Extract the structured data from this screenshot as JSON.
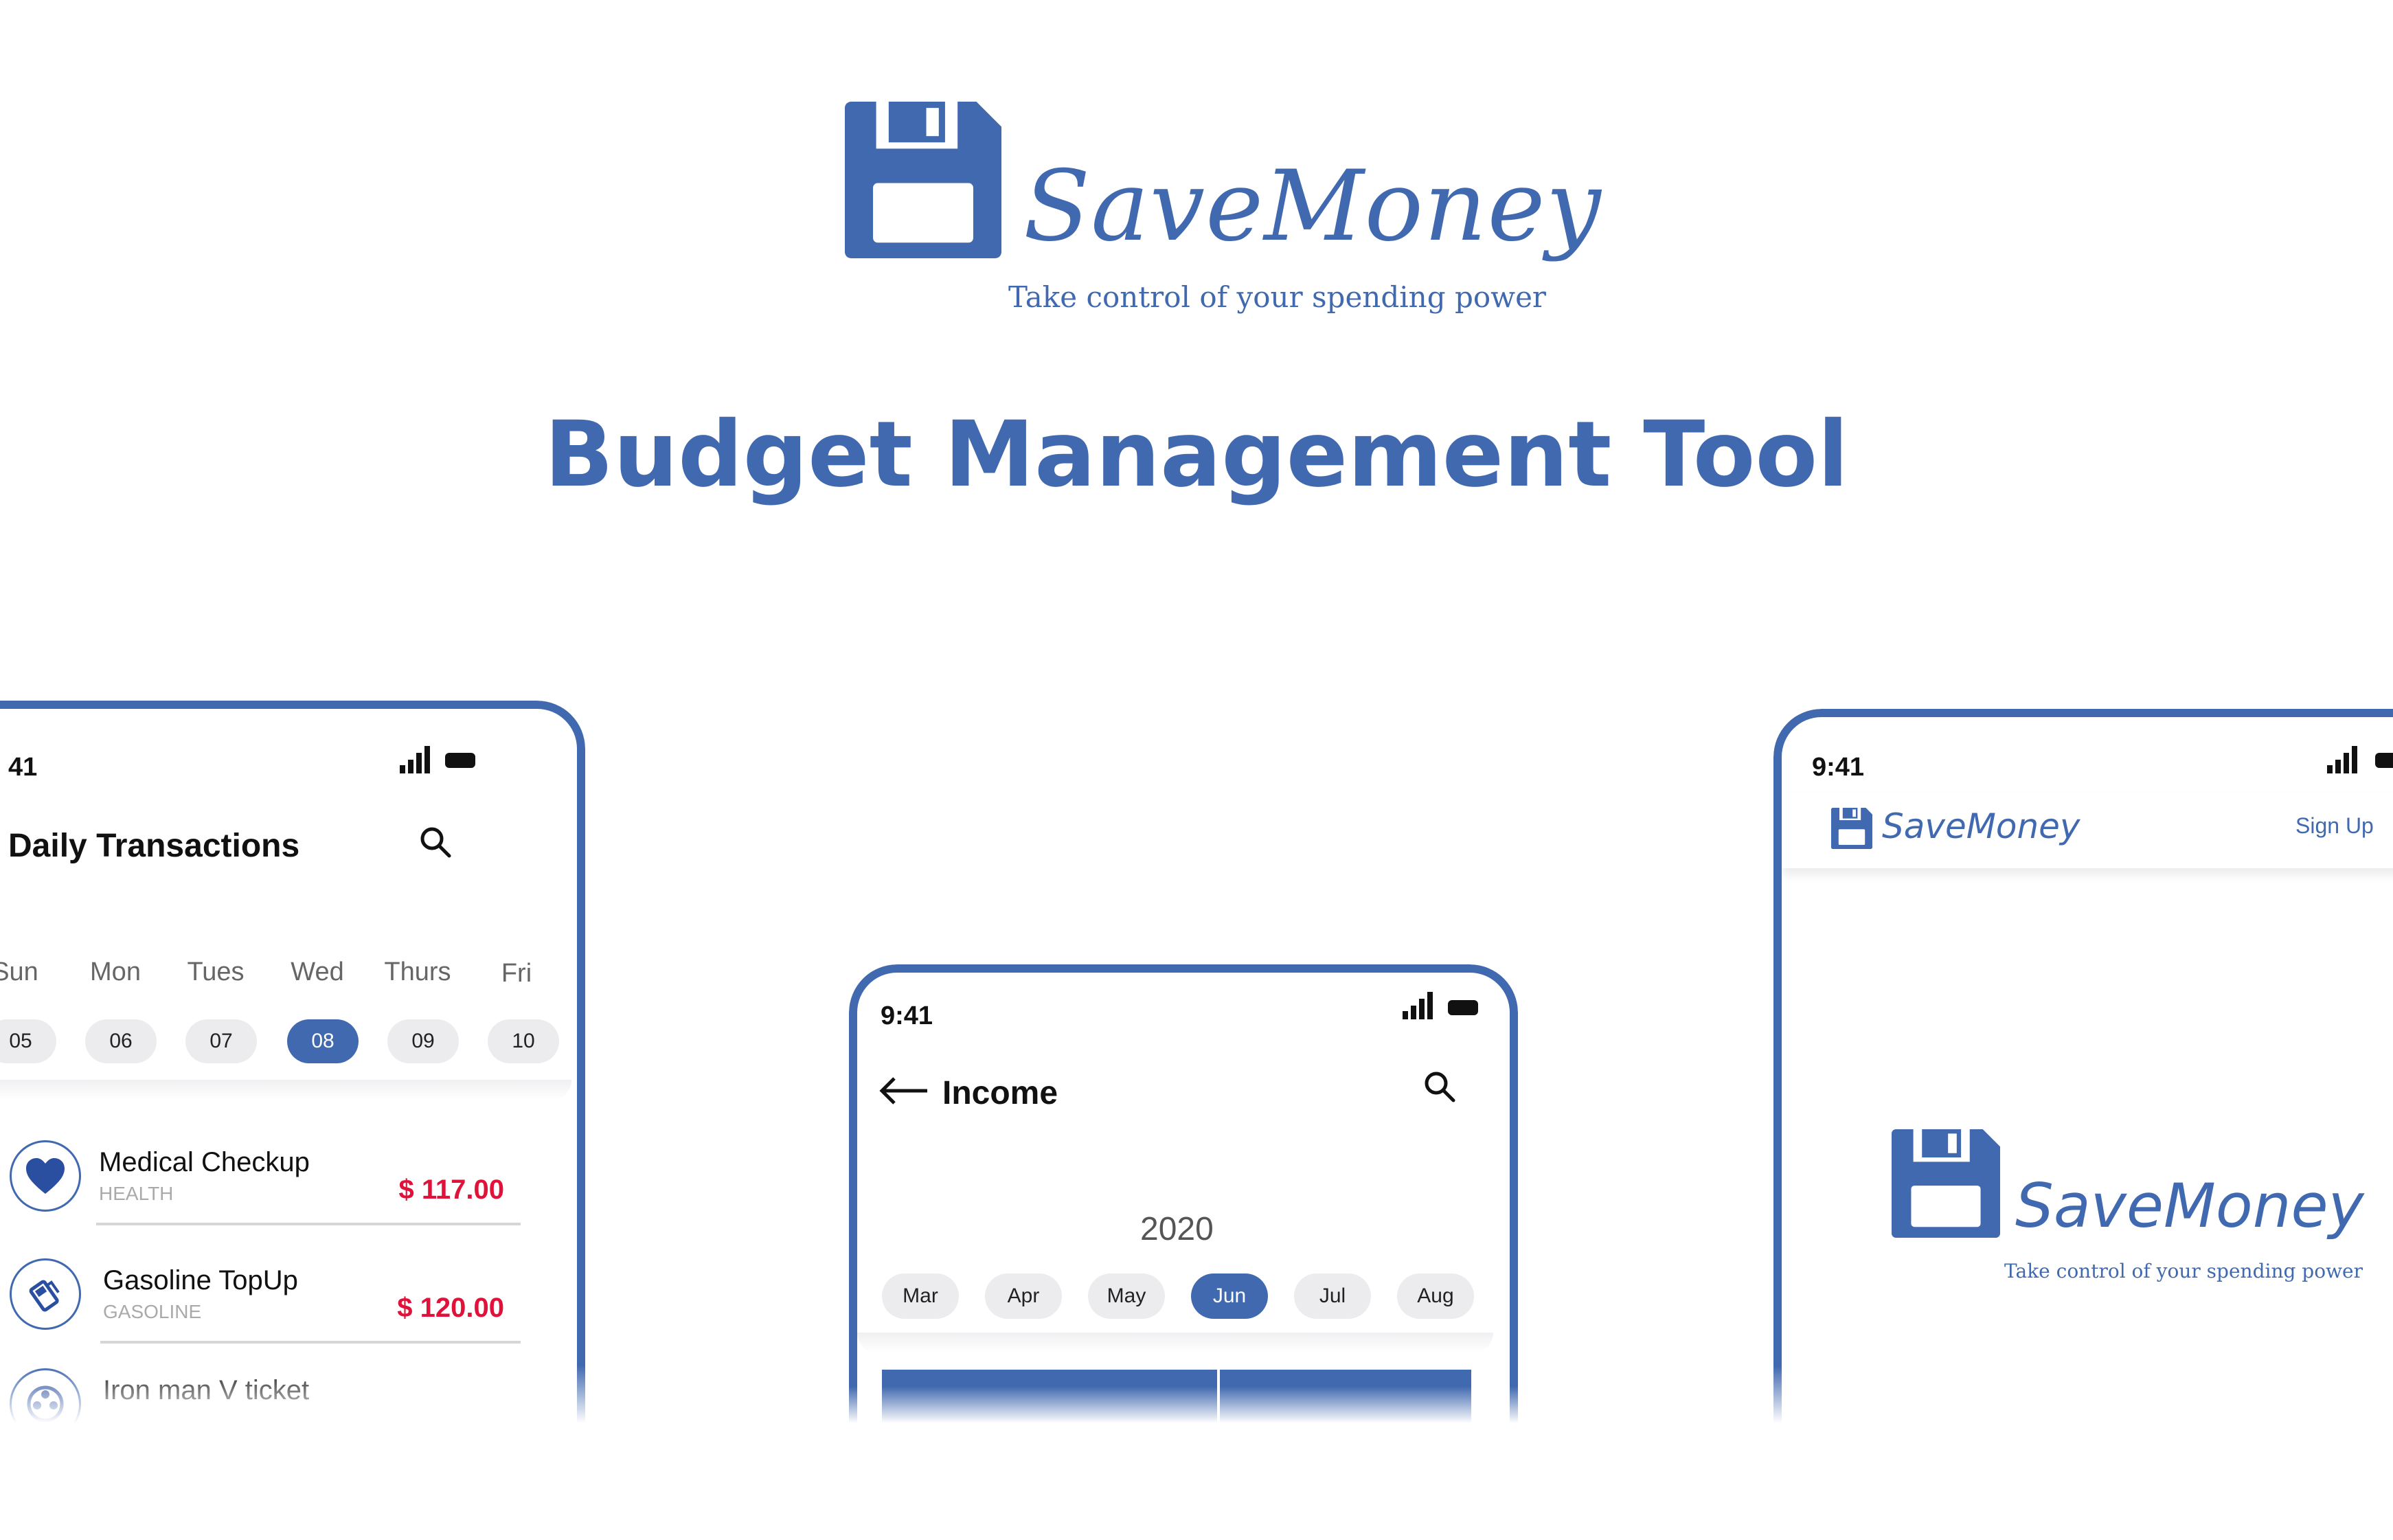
{
  "header": {
    "brand_name": "SaveMoney",
    "tagline": "Take control of your spending power",
    "title": "Budget Management Tool",
    "brand_color": "#4169b0"
  },
  "transactions_screen": {
    "status_time": "41",
    "title": "Daily Transactions",
    "days": [
      {
        "label": "Sun",
        "date": "05"
      },
      {
        "label": "Mon",
        "date": "06"
      },
      {
        "label": "Tues",
        "date": "07"
      },
      {
        "label": "Wed",
        "date": "08"
      },
      {
        "label": "Thurs",
        "date": "09"
      },
      {
        "label": "Fri",
        "date": "10"
      }
    ],
    "selected_date": "08",
    "transactions": [
      {
        "name": "Medical Checkup",
        "category": "HEALTH",
        "amount": "$ 117.00",
        "icon": "heart-icon"
      },
      {
        "name": "Gasoline TopUp",
        "category": "GASOLINE",
        "amount": "$ 120.00",
        "icon": "fuel-pump-icon"
      },
      {
        "name": "Iron man V ticket",
        "category": "",
        "amount": "",
        "icon": "film-reel-icon"
      }
    ],
    "amount_color": "#e0123a"
  },
  "income_screen": {
    "status_time": "9:41",
    "title": "Income",
    "year": "2020",
    "months": [
      "Mar",
      "Apr",
      "May",
      "Jun",
      "Jul",
      "Aug"
    ],
    "selected_month": "Jun"
  },
  "signup_screen": {
    "status_time": "9:41",
    "brand_name": "SaveMoney",
    "nav_link": "Sign Up",
    "splash_brand": "SaveMoney",
    "splash_tagline": "Take control of your spending power"
  }
}
